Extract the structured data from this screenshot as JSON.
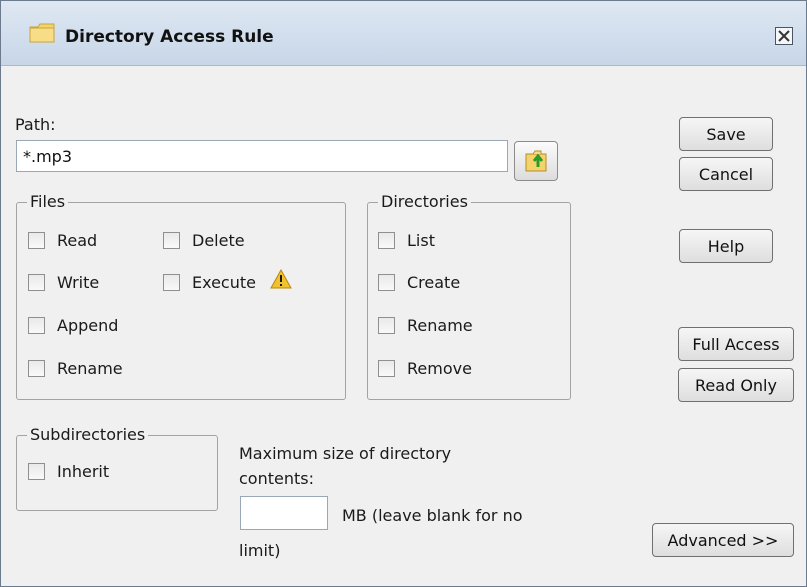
{
  "window": {
    "title": "Directory Access Rule"
  },
  "path": {
    "label": "Path:",
    "value": "*.mp3"
  },
  "files": {
    "legend": "Files",
    "read": "Read",
    "write": "Write",
    "append": "Append",
    "rename": "Rename",
    "delete": "Delete",
    "execute": "Execute"
  },
  "directories": {
    "legend": "Directories",
    "list": "List",
    "create": "Create",
    "rename": "Rename",
    "remove": "Remove"
  },
  "subdirectories": {
    "legend": "Subdirectories",
    "inherit": "Inherit"
  },
  "max_size": {
    "label_line1": "Maximum size of directory",
    "label_line2": "contents:",
    "value": "",
    "hint_line1": "MB (leave blank for no",
    "hint_line2": "limit)"
  },
  "buttons": {
    "save": "Save",
    "cancel": "Cancel",
    "help": "Help",
    "full_access": "Full Access",
    "read_only": "Read Only",
    "advanced": "Advanced >>"
  },
  "icons": {
    "title": "folder-icon",
    "close": "close-icon",
    "browse": "folder-browse-icon",
    "execute_warning": "warning-icon"
  },
  "checkbox_states": {
    "read": false,
    "write": false,
    "append": false,
    "rename_file": false,
    "delete": false,
    "execute": false,
    "list": false,
    "create": false,
    "rename_dir": false,
    "remove": false,
    "inherit": false
  },
  "colors": {
    "warning": "#f2c12e",
    "folder": "#f4d36b"
  }
}
